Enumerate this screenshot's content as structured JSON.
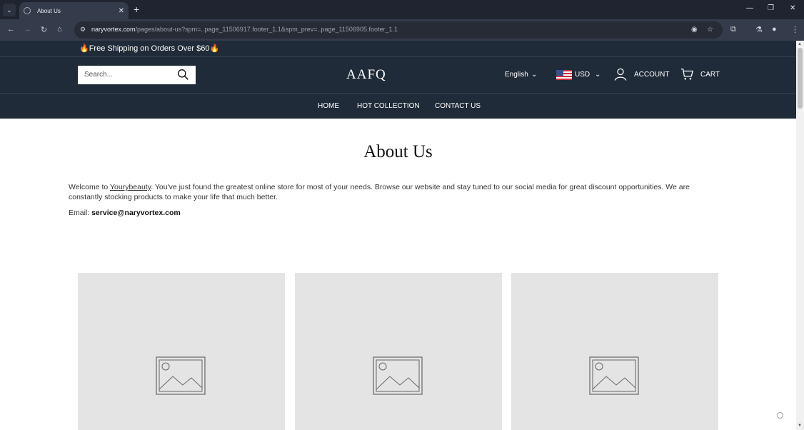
{
  "browser": {
    "tab_title": "About Us",
    "tab_close": "✕",
    "new_tab": "+",
    "tab_search": "⌄",
    "window_controls": [
      "—",
      "❐",
      "✕"
    ],
    "url_host": "naryvortex.com",
    "url_path": "/pages/about-us?spm=..page_11506917.footer_1.1&spm_prev=..page_11506905.footer_1.1"
  },
  "store": {
    "announcement": "🔥Free Shipping on Orders Over $60🔥",
    "search_placeholder": "Search...",
    "logo": "AAFQ",
    "language": "English",
    "currency": "USD",
    "account": "ACCOUNT",
    "cart": "CART",
    "menu": [
      "HOME",
      "HOT COLLECTION",
      "CONTACT US"
    ]
  },
  "content": {
    "title": "About Us",
    "intro_before": "Welcome to ",
    "intro_link": "Yourybeauty",
    "intro_after": ". You've just found the greatest online store for most of your needs. Browse our website and stay tuned to our social media for great discount opportunities. We are constantly stocking products to make your life that much better.",
    "email_label": "Email: ",
    "email_value": "service@naryvortex.com"
  },
  "colors": {
    "header_bg": "#1f2b38",
    "placeholder_bg": "#e4e4e4"
  }
}
